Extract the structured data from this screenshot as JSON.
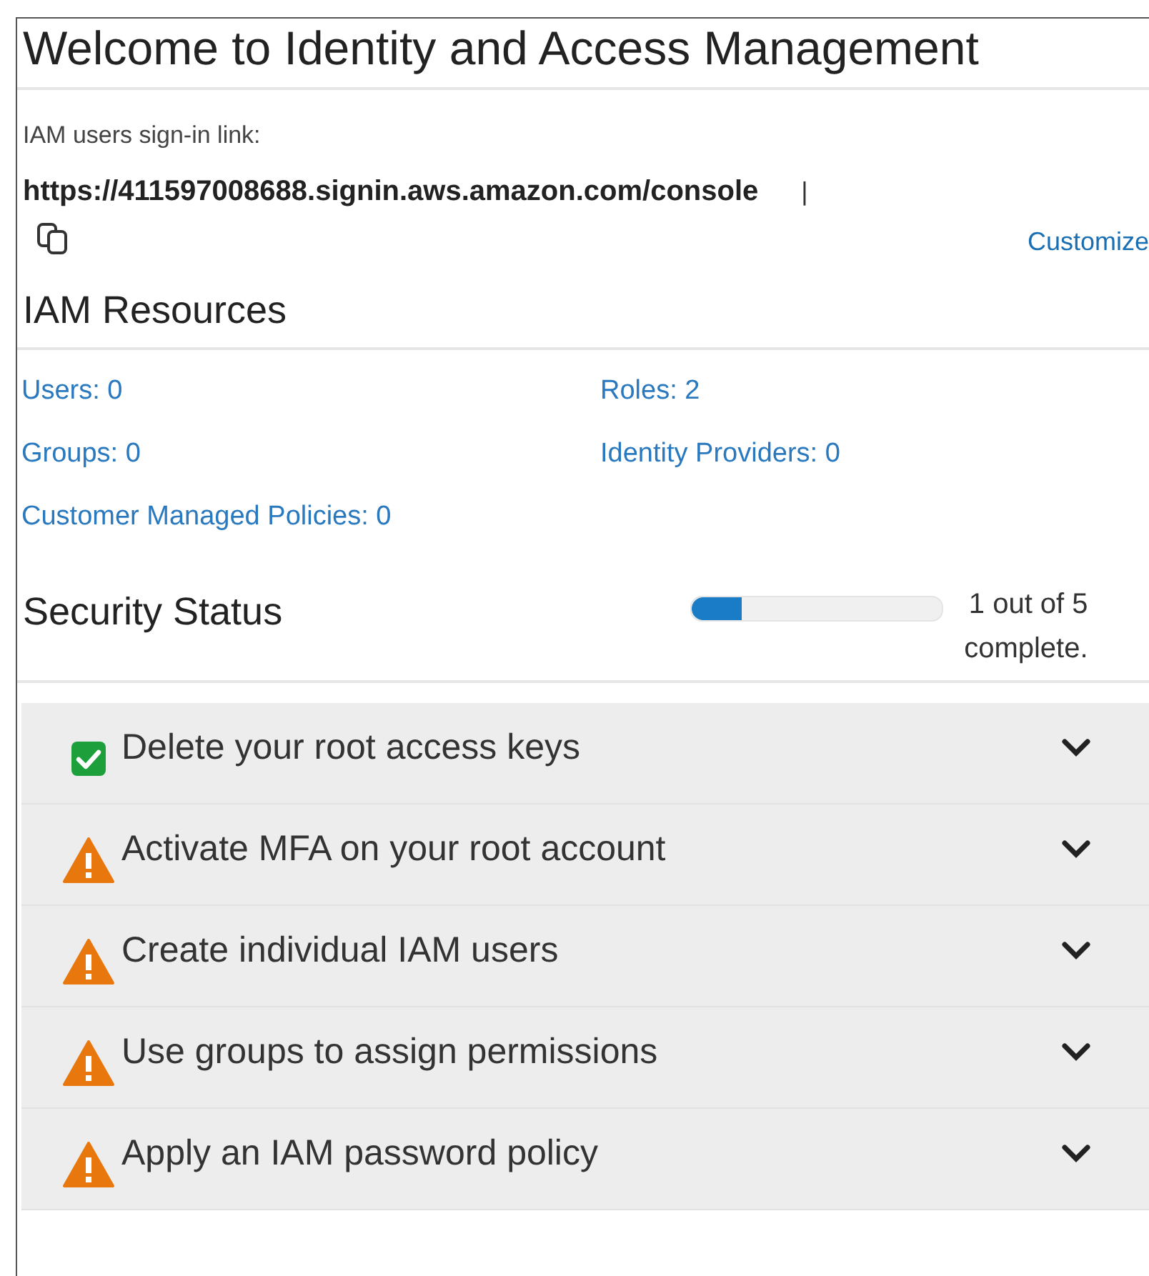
{
  "title": "Welcome to Identity and Access Management",
  "sign_in": {
    "label": "IAM users sign-in link:",
    "url": "https://411597008688.signin.aws.amazon.com/console",
    "separator": "|",
    "customize": "Customize"
  },
  "resources": {
    "heading": "IAM Resources",
    "links": [
      {
        "text": "Users: 0"
      },
      {
        "text": "Roles: 2"
      },
      {
        "text": "Groups: 0"
      },
      {
        "text": "Identity Providers: 0"
      },
      {
        "text": "Customer Managed Policies: 0"
      }
    ]
  },
  "security": {
    "heading": "Security Status",
    "level": 0.2,
    "progress_text": "1 out of 5",
    "progress_text_2": "complete.",
    "items": [
      {
        "kind": "done",
        "label": "Delete your root access keys",
        "expanded": false
      },
      {
        "kind": "warning",
        "label": "Activate MFA on your root account",
        "expanded": false
      },
      {
        "kind": "warning",
        "label": "Create individual IAM users",
        "expanded": false
      },
      {
        "kind": "warning",
        "label": "Use groups to assign permissions",
        "expanded": false
      },
      {
        "kind": "warning",
        "label": "Apply an IAM password policy",
        "expanded": false
      }
    ]
  }
}
